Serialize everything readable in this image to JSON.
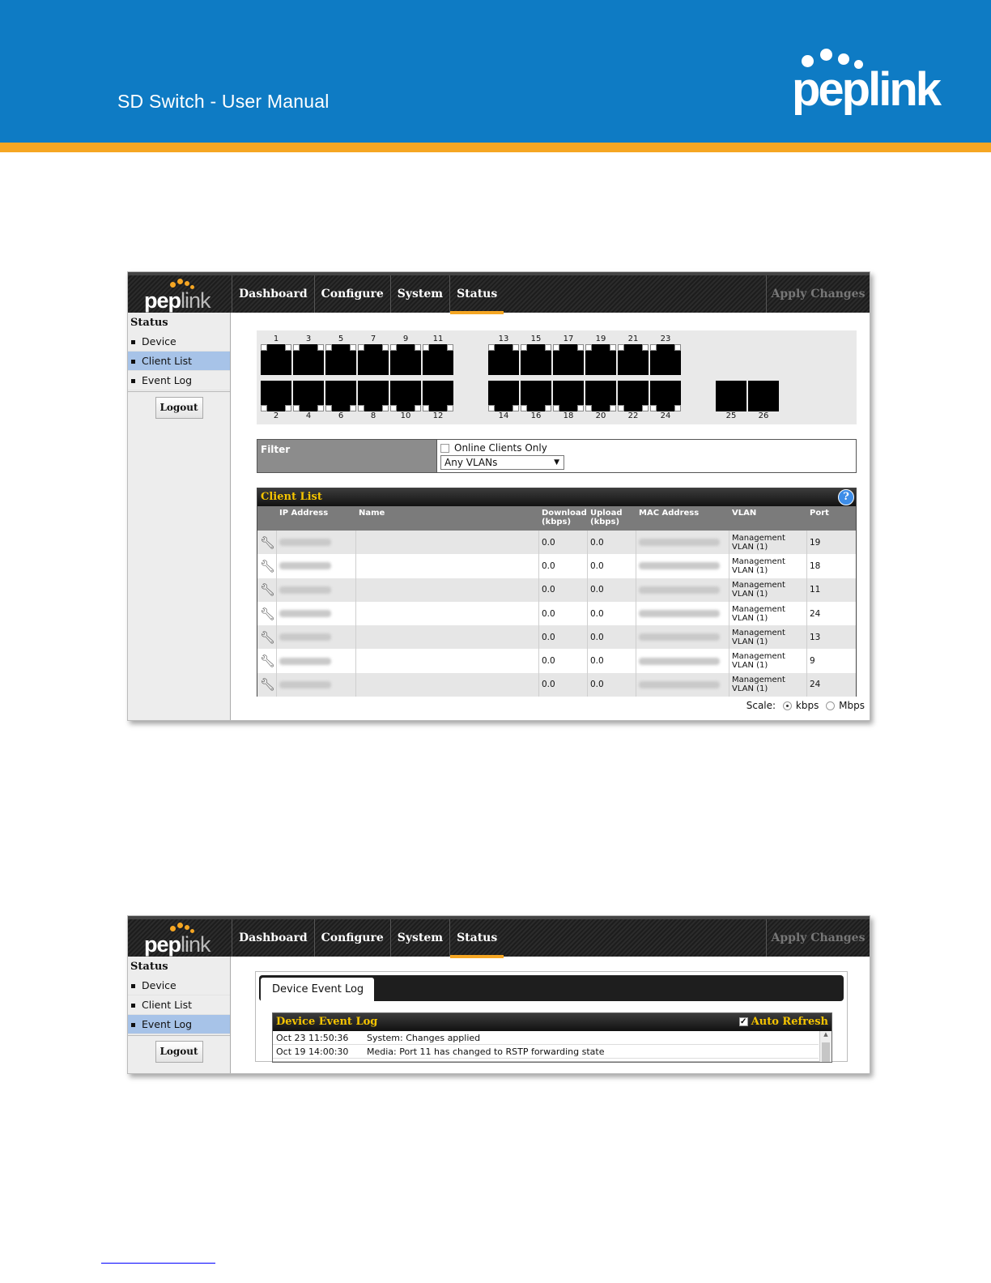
{
  "doc": {
    "title": "SD Switch  - User Manual",
    "brand": "peplink"
  },
  "app": {
    "logo_main": "pep",
    "logo_light": "link",
    "nav": [
      "Dashboard",
      "Configure",
      "System",
      "Status"
    ],
    "active_nav": "Status",
    "apply_label": "Apply Changes",
    "sidebar_title": "Status",
    "sidebar_items": [
      "Device",
      "Client List",
      "Event Log"
    ],
    "logout_label": "Logout"
  },
  "ports": {
    "top_numbers": [
      "1",
      "3",
      "5",
      "7",
      "9",
      "11",
      "13",
      "15",
      "17",
      "19",
      "21",
      "23"
    ],
    "bottom_numbers": [
      "2",
      "4",
      "6",
      "8",
      "10",
      "12",
      "14",
      "16",
      "18",
      "20",
      "22",
      "24"
    ],
    "sfp_numbers": [
      "25",
      "26"
    ]
  },
  "filter": {
    "label": "Filter",
    "online_only_label": "Online Clients Only",
    "online_only_checked": false,
    "vlan_selected": "Any VLANs"
  },
  "client_list": {
    "title": "Client List",
    "help_icon": "?",
    "columns": [
      "IP Address",
      "Name",
      "Download\n(kbps)",
      "Upload\n(kbps)",
      "MAC Address",
      "VLAN",
      "Port"
    ],
    "rows": [
      {
        "download": "0.0",
        "upload": "0.0",
        "vlan": "Management\nVLAN (1)",
        "port": "19"
      },
      {
        "download": "0.0",
        "upload": "0.0",
        "vlan": "Management\nVLAN (1)",
        "port": "18"
      },
      {
        "download": "0.0",
        "upload": "0.0",
        "vlan": "Management\nVLAN (1)",
        "port": "11"
      },
      {
        "download": "0.0",
        "upload": "0.0",
        "vlan": "Management\nVLAN (1)",
        "port": "24"
      },
      {
        "download": "0.0",
        "upload": "0.0",
        "vlan": "Management\nVLAN (1)",
        "port": "13"
      },
      {
        "download": "0.0",
        "upload": "0.0",
        "vlan": "Management\nVLAN (1)",
        "port": "9"
      },
      {
        "download": "0.0",
        "upload": "0.0",
        "vlan": "Management\nVLAN (1)",
        "port": "24"
      }
    ],
    "scale_label": "Scale:",
    "scale_options": [
      "kbps",
      "Mbps"
    ],
    "scale_selected": "kbps"
  },
  "event_log": {
    "tab_label": "Device Event Log",
    "title": "Device Event Log",
    "auto_refresh_label": "Auto Refresh",
    "auto_refresh_checked": true,
    "entries": [
      {
        "time": "Oct 23 11:50:36",
        "message": "System: Changes applied"
      },
      {
        "time": "Oct 19 14:00:30",
        "message": "Media: Port 11 has changed to RSTP forwarding state"
      }
    ]
  },
  "colors": {
    "header_blue": "#0e7bc4",
    "accent_orange": "#f5a623",
    "selected_blue": "#a7c3e8",
    "panel_title_yellow": "#f5c400"
  }
}
